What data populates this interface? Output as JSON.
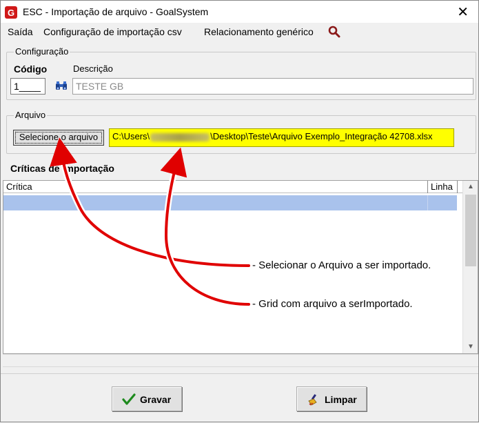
{
  "window": {
    "title": "ESC - Importação de arquivo - GoalSystem",
    "close_glyph": "✕"
  },
  "menu": {
    "items": [
      "Saída",
      "Configuração de importação csv",
      "Relacionamento genérico"
    ],
    "search_icon": "search-icon"
  },
  "config": {
    "legend": "Configuração",
    "codigo_label": "Código",
    "descricao_label": "Descrição",
    "codigo_value": "1____",
    "descricao_value": "TESTE GB"
  },
  "arquivo": {
    "legend": "Arquivo",
    "select_button": "Selecione o arquivo",
    "path_prefix": "C:\\Users\\",
    "path_suffix": "\\Desktop\\Teste\\Arquivo Exemplo_Integração 42708.xlsx",
    "highlight_color": "#ffff00"
  },
  "criticas": {
    "title": "Críticas de importação",
    "columns": [
      "Crítica",
      "Linha"
    ]
  },
  "buttons": {
    "gravar": "Gravar",
    "limpar": "Limpar"
  },
  "annotations": {
    "callout_1": "- Selecionar o Arquivo a ser importado.",
    "callout_2": "- Grid com arquivo a serImportado.",
    "arrow_color": "#e00000"
  }
}
